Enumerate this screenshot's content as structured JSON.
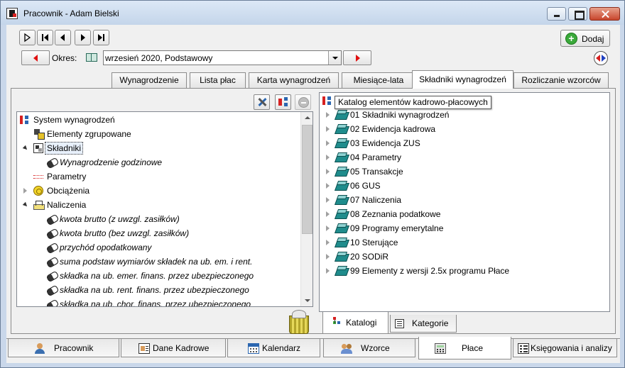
{
  "window": {
    "title": "Pracownik - Adam Bielski",
    "minimize_icon": "minimize-icon",
    "maximize_icon": "maximize-icon",
    "close_icon": "close-icon"
  },
  "toolbar": {
    "add_label": "Dodaj",
    "nav_first": "first-record-icon",
    "nav_prev": "previous-record-icon",
    "nav_next": "next-record-icon",
    "nav_last": "last-record-icon"
  },
  "okres": {
    "label": "Okres:",
    "value": "wrzesień 2020, Podstawowy"
  },
  "top_tabs": [
    {
      "label": "Wynagrodzenie"
    },
    {
      "label": "Lista płac"
    },
    {
      "label": "Karta wynagrodzeń"
    },
    {
      "label": "Miesiące-lata"
    },
    {
      "label": "Składniki wynagrodzeń"
    },
    {
      "label": "Rozliczanie wzorców"
    }
  ],
  "left_tree": [
    {
      "label": "System wynagrodzeń",
      "icon": "system-icon"
    },
    {
      "label": "Elementy zgrupowane",
      "icon": "group-icon"
    },
    {
      "label": "Składniki",
      "icon": "components-icon"
    },
    {
      "label": "Wynagrodzenie godzinowe",
      "icon": "pill-icon"
    },
    {
      "label": "Parametry",
      "icon": "parameters-icon"
    },
    {
      "label": "Obciążenia",
      "icon": "charges-icon"
    },
    {
      "label": "Naliczenia",
      "icon": "accruals-icon"
    },
    {
      "label": "kwota brutto (z uwzgl. zasiłków)",
      "icon": "pill-icon"
    },
    {
      "label": "kwota brutto (bez uwzgl. zasiłków)",
      "icon": "pill-icon"
    },
    {
      "label": "przychód opodatkowany",
      "icon": "pill-icon"
    },
    {
      "label": "suma podstaw wymiarów składek na ub. em. i rent.",
      "icon": "pill-icon"
    },
    {
      "label": "składka na ub. emer. finans. przez ubezpieczonego",
      "icon": "pill-icon"
    },
    {
      "label": "składka na ub. rent. finans. przez ubezpieczonego",
      "icon": "pill-icon"
    },
    {
      "label": "składka na ub. chor. finans. przez ubezpieczonego",
      "icon": "pill-icon"
    }
  ],
  "right_tree": {
    "tooltip": "Katalog elementów kadrowo-płacowych",
    "items": [
      {
        "label": "01 Składniki wynagrodzeń"
      },
      {
        "label": "02 Ewidencja kadrowa"
      },
      {
        "label": "03 Ewidencja ZUS"
      },
      {
        "label": "04 Parametry"
      },
      {
        "label": "05 Transakcje"
      },
      {
        "label": "06 GUS"
      },
      {
        "label": "07 Naliczenia"
      },
      {
        "label": "08 Zeznania podatkowe"
      },
      {
        "label": "09 Programy emerytalne"
      },
      {
        "label": "10 Sterujące"
      },
      {
        "label": "20 SODiR"
      },
      {
        "label": "99 Elementy z wersji 2.5x programu Płace"
      }
    ]
  },
  "sub_tabs": [
    {
      "label": "Katalogi"
    },
    {
      "label": "Kategorie"
    }
  ],
  "bottom_tabs": [
    {
      "label": "Pracownik"
    },
    {
      "label": "Dane Kadrowe"
    },
    {
      "label": "Kalendarz"
    },
    {
      "label": "Wzorce"
    },
    {
      "label": "Płace"
    },
    {
      "label": "Księgowania i analizy"
    }
  ]
}
